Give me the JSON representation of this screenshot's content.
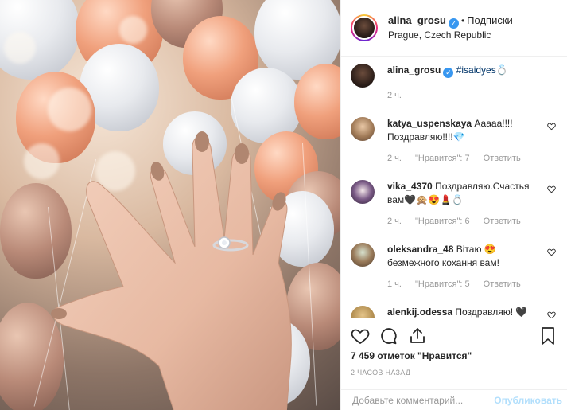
{
  "post": {
    "username": "alina_grosu",
    "verified_mark": "✓",
    "follow_label": "Подписки",
    "location": "Prague, Czech Republic"
  },
  "caption": {
    "username": "alina_grosu",
    "text": "#isaidyes💍 ",
    "time": "2 ч."
  },
  "comments": [
    {
      "username": "katya_uspenskaya",
      "text": "Ааааа!!!! Поздравляю!!!!💎",
      "time": "2 ч.",
      "likes": "\"Нравится\": 7",
      "reply": "Ответить"
    },
    {
      "username": "vika_4370",
      "text": "Поздравляю.Счастья вам🖤🙊😍💄💍",
      "time": "2 ч.",
      "likes": "\"Нравится\": 6",
      "reply": "Ответить"
    },
    {
      "username": "oleksandra_48",
      "text": "Вітаю 😍 безмежного кохання вам!",
      "time": "1 ч.",
      "likes": "\"Нравится\": 5",
      "reply": "Ответить"
    },
    {
      "username": "alenkij.odessa",
      "text": "Поздравляю! 🖤",
      "time": "",
      "likes": "",
      "reply": ""
    }
  ],
  "actions": {
    "like_icon": "heart-icon",
    "comment_icon": "comment-icon",
    "share_icon": "share-icon",
    "save_icon": "bookmark-icon",
    "likes_text": "7 459 отметок \"Нравится\"",
    "posted_ago": "2 ЧАСОВ НАЗАД"
  },
  "composer": {
    "placeholder": "Добавьте комментарий...",
    "publish_label": "Опубликовать"
  },
  "colors": {
    "link_blue": "#3897f0",
    "hashtag": "#003569",
    "muted": "#999999",
    "publish_disabled": "#b2dffc"
  }
}
